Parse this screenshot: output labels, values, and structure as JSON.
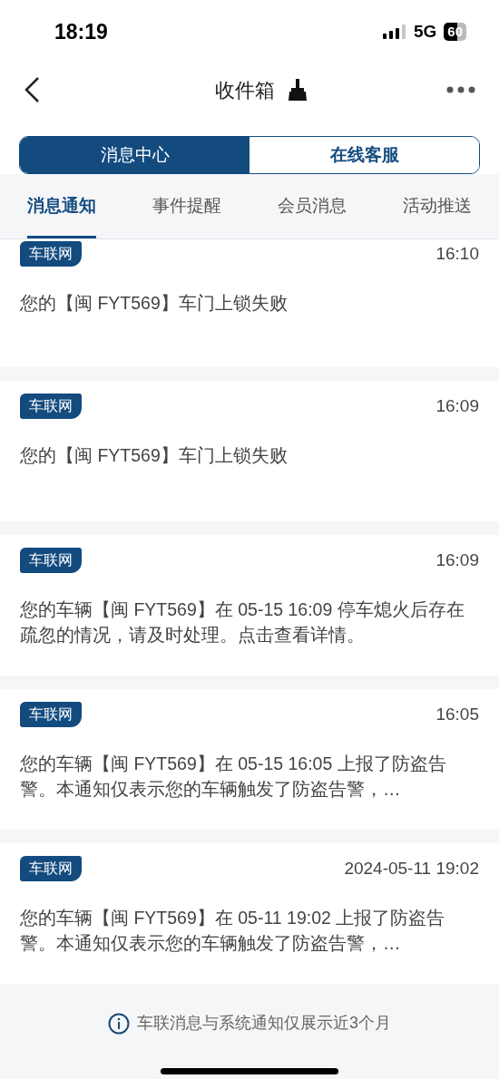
{
  "status_bar": {
    "time": "18:19",
    "network": "5G",
    "battery": "60"
  },
  "nav": {
    "title": "收件箱"
  },
  "segments": [
    {
      "label": "消息中心",
      "selected": true
    },
    {
      "label": "在线客服",
      "selected": false
    }
  ],
  "tabs": [
    {
      "label": "消息通知",
      "selected": true
    },
    {
      "label": "事件提醒",
      "selected": false
    },
    {
      "label": "会员消息",
      "selected": false
    },
    {
      "label": "活动推送",
      "selected": false
    }
  ],
  "messages": [
    {
      "tag": "车联网",
      "time": "16:10",
      "text": "您的【闽 FYT569】车门上锁失败"
    },
    {
      "tag": "车联网",
      "time": "16:09",
      "text": "您的【闽 FYT569】车门上锁失败"
    },
    {
      "tag": "车联网",
      "time": "16:09",
      "text": "您的车辆【闽 FYT569】在 05-15 16:09 停车熄火后存在疏忽的情况，请及时处理。点击查看详情。"
    },
    {
      "tag": "车联网",
      "time": "16:05",
      "text": "您的车辆【闽 FYT569】在 05-15 16:05 上报了防盗告警。本通知仅表示您的车辆触发了防盗告警，…"
    },
    {
      "tag": "车联网",
      "time": "2024-05-11 19:02",
      "text": "您的车辆【闽 FYT569】在 05-11 19:02 上报了防盗告警。本通知仅表示您的车辆触发了防盗告警，…"
    }
  ],
  "footer": {
    "note": "车联消息与系统通知仅展示近3个月"
  }
}
